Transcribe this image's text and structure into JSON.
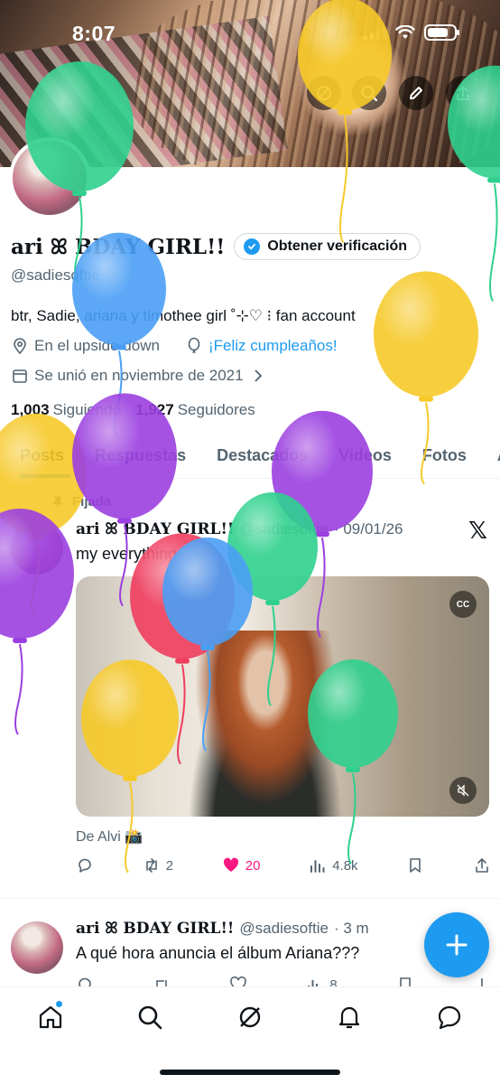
{
  "status_bar": {
    "time": "8:07"
  },
  "profile": {
    "display_name": "ari ꕤ BDAY GIRL!!",
    "verify_label": "Obtener verificación",
    "handle": "@sadiesoftie",
    "bio": "btr, Sadie, ariana y timothee girl ˚⊹♡ ⁝ fan account",
    "location": "En el upside down",
    "birthday": "¡Feliz cumpleaños!",
    "joined": "Se unió en noviembre de 2021",
    "following_count": "1,003",
    "following_label": "Siguiendo",
    "followers_count": "1,927",
    "followers_label": "Seguidores"
  },
  "tabs": [
    "Posts",
    "Respuestas",
    "Destacados",
    "Videos",
    "Fotos",
    "A"
  ],
  "pinned_tweet": {
    "pinned_label": "Fijada",
    "name": "ari ꕤ BDAY GIRL!!",
    "handle": "@sadiesoftie",
    "date": "· 09/01/26",
    "text": "my everything",
    "media_credit": "De Alvi 📸",
    "retweets": "2",
    "likes": "20",
    "views": "4.8k",
    "cc_label": "CC"
  },
  "second_tweet": {
    "name": "ari ꕤ BDAY GIRL!!",
    "handle": "@sadiesoftie",
    "time": "· 3 m",
    "text": "A qué hora anuncia el álbum Ariana???",
    "views": "8"
  },
  "icons": {
    "header": [
      "grok-icon",
      "search-icon",
      "edit-icon",
      "share-icon"
    ],
    "nav": [
      "home-icon",
      "search-icon",
      "grok-icon",
      "notifications-icon",
      "messages-icon"
    ],
    "fab": "plus-icon"
  },
  "colors": {
    "accent": "#1d9bf0",
    "like": "#f91880",
    "text": "#0f1419",
    "muted": "#536471",
    "balloon_yellow": "#f6c928",
    "balloon_green": "#2fd08e",
    "balloon_blue": "#4a9ff5",
    "balloon_purple": "#9b3fe0",
    "balloon_red": "#ef3d5e"
  }
}
